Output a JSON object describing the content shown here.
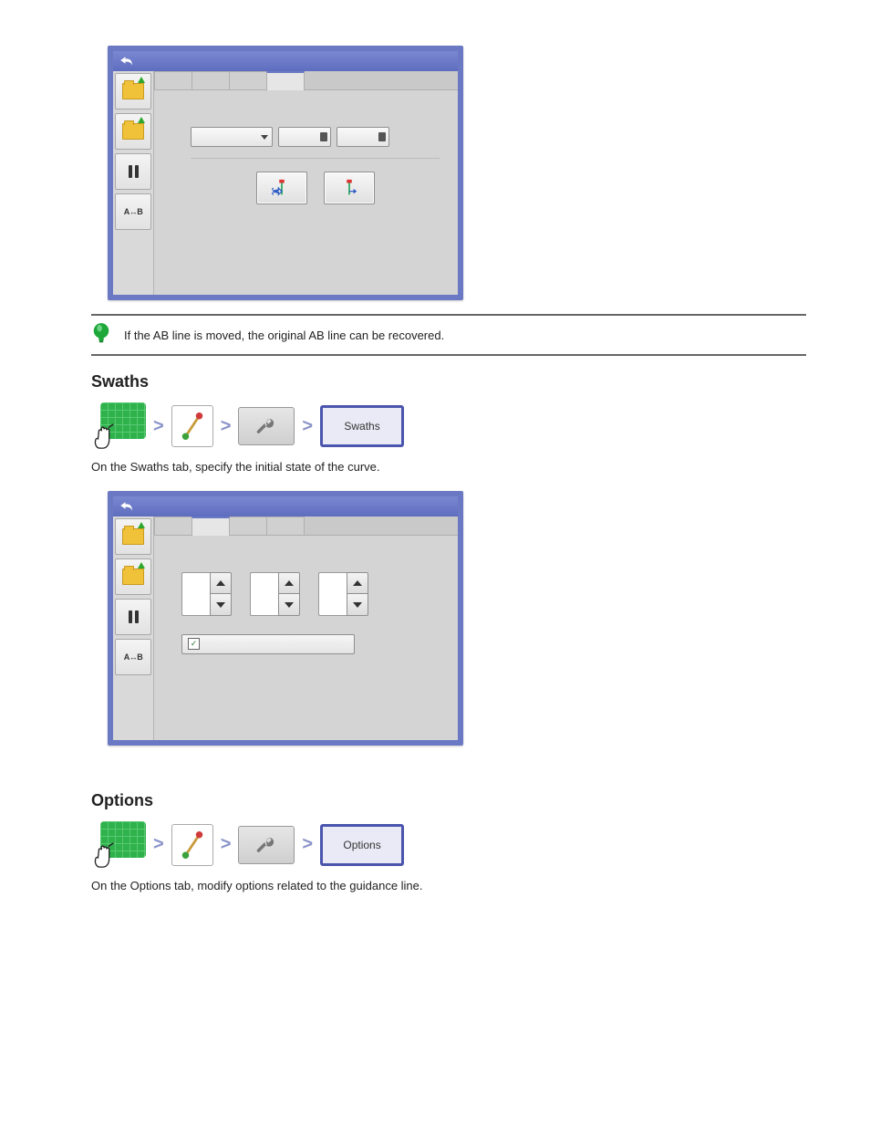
{
  "sections": {
    "tip": {
      "text": "If the AB line is moved, the original AB line can be recovered."
    },
    "swaths": {
      "heading": "Swaths",
      "desc": "On the Swaths tab, specify the initial state of the curve.",
      "crumb_final": "Swaths"
    },
    "options": {
      "heading": "Options",
      "desc": "On the Options tab, modify options related to the guidance line.",
      "crumb_final": "Options"
    }
  },
  "window1": {
    "tabs": [
      "",
      "",
      "",
      ""
    ],
    "active_tab_index": 3,
    "sidebar": [
      "open-folder",
      "import-folder",
      "pause",
      "a-to-b"
    ],
    "combo_value": "",
    "num1": "",
    "num2": ""
  },
  "window2": {
    "tabs": [
      "",
      "",
      "",
      ""
    ],
    "active_tab_index": 1,
    "sidebar": [
      "open-folder",
      "import-folder",
      "pause",
      "a-to-b"
    ],
    "spinner1": "",
    "spinner2": "",
    "spinner3": "",
    "checkbox_label": "",
    "checkbox_checked": true
  }
}
